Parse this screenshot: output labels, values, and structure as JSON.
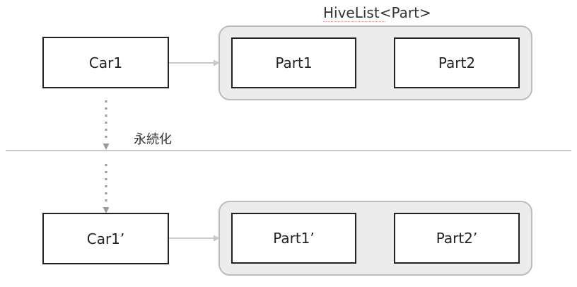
{
  "diagram": {
    "top": {
      "source": "Car1",
      "container_label": "HiveList<Part>",
      "items": [
        "Part1",
        "Part2"
      ]
    },
    "bottom": {
      "source": "Car1’",
      "items": [
        "Part1’",
        "Part2’"
      ]
    },
    "persist_label": "永続化"
  },
  "colors": {
    "box_border": "#222222",
    "container_fill": "#ececec",
    "container_border": "#bcbcbc",
    "arrow": "#c8c8c8",
    "dotted_arrow": "#9a9a9a",
    "separator": "#c8c8c8"
  }
}
